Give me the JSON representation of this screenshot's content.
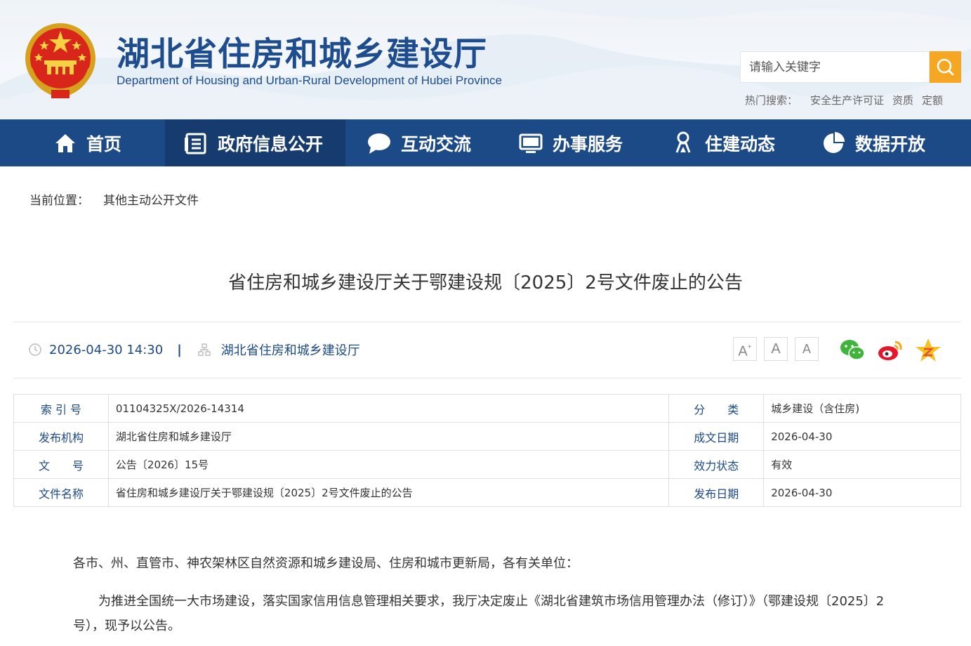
{
  "header": {
    "title": "湖北省住房和城乡建设厅",
    "subtitle": "Department of Housing and Urban-Rural Development of Hubei Province",
    "search_placeholder": "请输入关键字",
    "hot_label": "热门搜索：",
    "hot_terms": [
      "安全生产许可证",
      "资质",
      "定额"
    ]
  },
  "nav": {
    "items": [
      {
        "label": "首页",
        "icon": "home-icon"
      },
      {
        "label": "政府信息公开",
        "icon": "document-list-icon"
      },
      {
        "label": "互动交流",
        "icon": "chat-bubble-icon"
      },
      {
        "label": "办事服务",
        "icon": "monitor-icon"
      },
      {
        "label": "住建动态",
        "icon": "person-pin-icon"
      },
      {
        "label": "数据开放",
        "icon": "pie-chart-icon"
      }
    ],
    "active_index": 1
  },
  "breadcrumb": {
    "label": "当前位置：",
    "current": "其他主动公开文件"
  },
  "article": {
    "title": "省住房和城乡建设厅关于鄂建设规〔2025〕2号文件废止的公告",
    "datetime": "2026-04-30 14:30",
    "separator": "|",
    "source": "湖北省住房和城乡建设厅",
    "font_sizes": {
      "large": "A",
      "medium": "A",
      "small": "A",
      "large_mark": "+"
    },
    "share": [
      "wechat-icon",
      "weibo-icon",
      "qzone-icon"
    ]
  },
  "info_table": {
    "rows": [
      {
        "k1": "索 引 号",
        "v1": "01104325X/2026-14314",
        "k2": "分　　类",
        "v2": "城乡建设（含住房)"
      },
      {
        "k1": "发布机构",
        "v1": "湖北省住房和城乡建设厅",
        "k2": "成文日期",
        "v2": "2026-04-30"
      },
      {
        "k1": "文　　号",
        "v1": "公告〔2026〕15号",
        "k2": "效力状态",
        "v2": "有效"
      },
      {
        "k1": "文件名称",
        "v1": "省住房和城乡建设厅关于鄂建设规〔2025〕2号文件废止的公告",
        "k2": "发布日期",
        "v2": "2026-04-30"
      }
    ]
  },
  "body": {
    "salutation": "各市、州、直管市、神农架林区自然资源和城乡建设局、住房和城市更新局，各有关单位：",
    "para1_line1": "为推进全国统一大市场建设，落实国家信用信息管理相关要求，我厅决定废止《湖北省建筑市场信用管理办法（修订）》（鄂建设规〔2025〕2",
    "para1_line2": "号），现予以公告。"
  },
  "colors": {
    "nav_bg": "#1c4a87",
    "nav_active": "#163c6f",
    "brand_text": "#1d4d8e",
    "search_btn": "#f5a623"
  }
}
